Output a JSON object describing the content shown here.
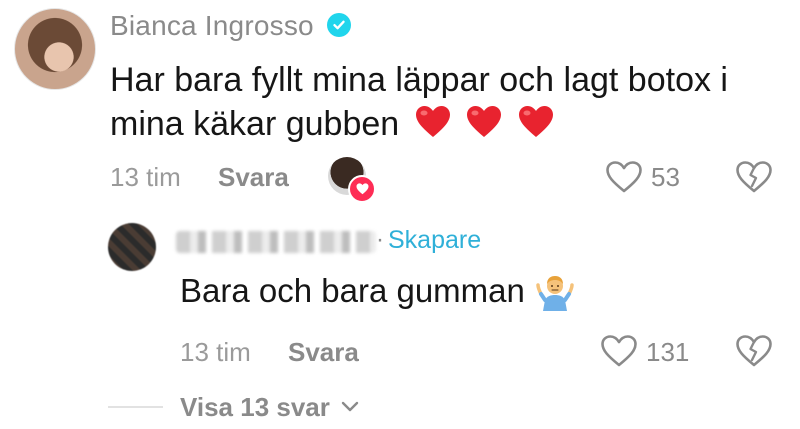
{
  "comment": {
    "username": "Bianca Ingrosso",
    "text_line1": "Har bara fyllt mina läppar och lagt botox i",
    "text_line2": "mina käkar gubben",
    "emoji_count": 3,
    "time": "13 tim",
    "reply_label": "Svara",
    "like_count": "53"
  },
  "reply": {
    "creator_label": "Skapare",
    "separator": "·",
    "text": "Bara och bara gumman",
    "time": "13 tim",
    "reply_label": "Svara",
    "like_count": "131"
  },
  "view_replies": {
    "label": "Visa 13 svar",
    "chevron": "⌄"
  },
  "colors": {
    "accent_heart": "#fe2c55",
    "verified": "#20d5ec",
    "creator": "#2fb0d8",
    "muted": "#8a8a8a"
  },
  "icons": [
    "verified-badge-icon",
    "red-heart-emoji",
    "heart-outline-icon",
    "broken-heart-icon",
    "person-shrugging-emoji",
    "chevron-down-icon"
  ]
}
